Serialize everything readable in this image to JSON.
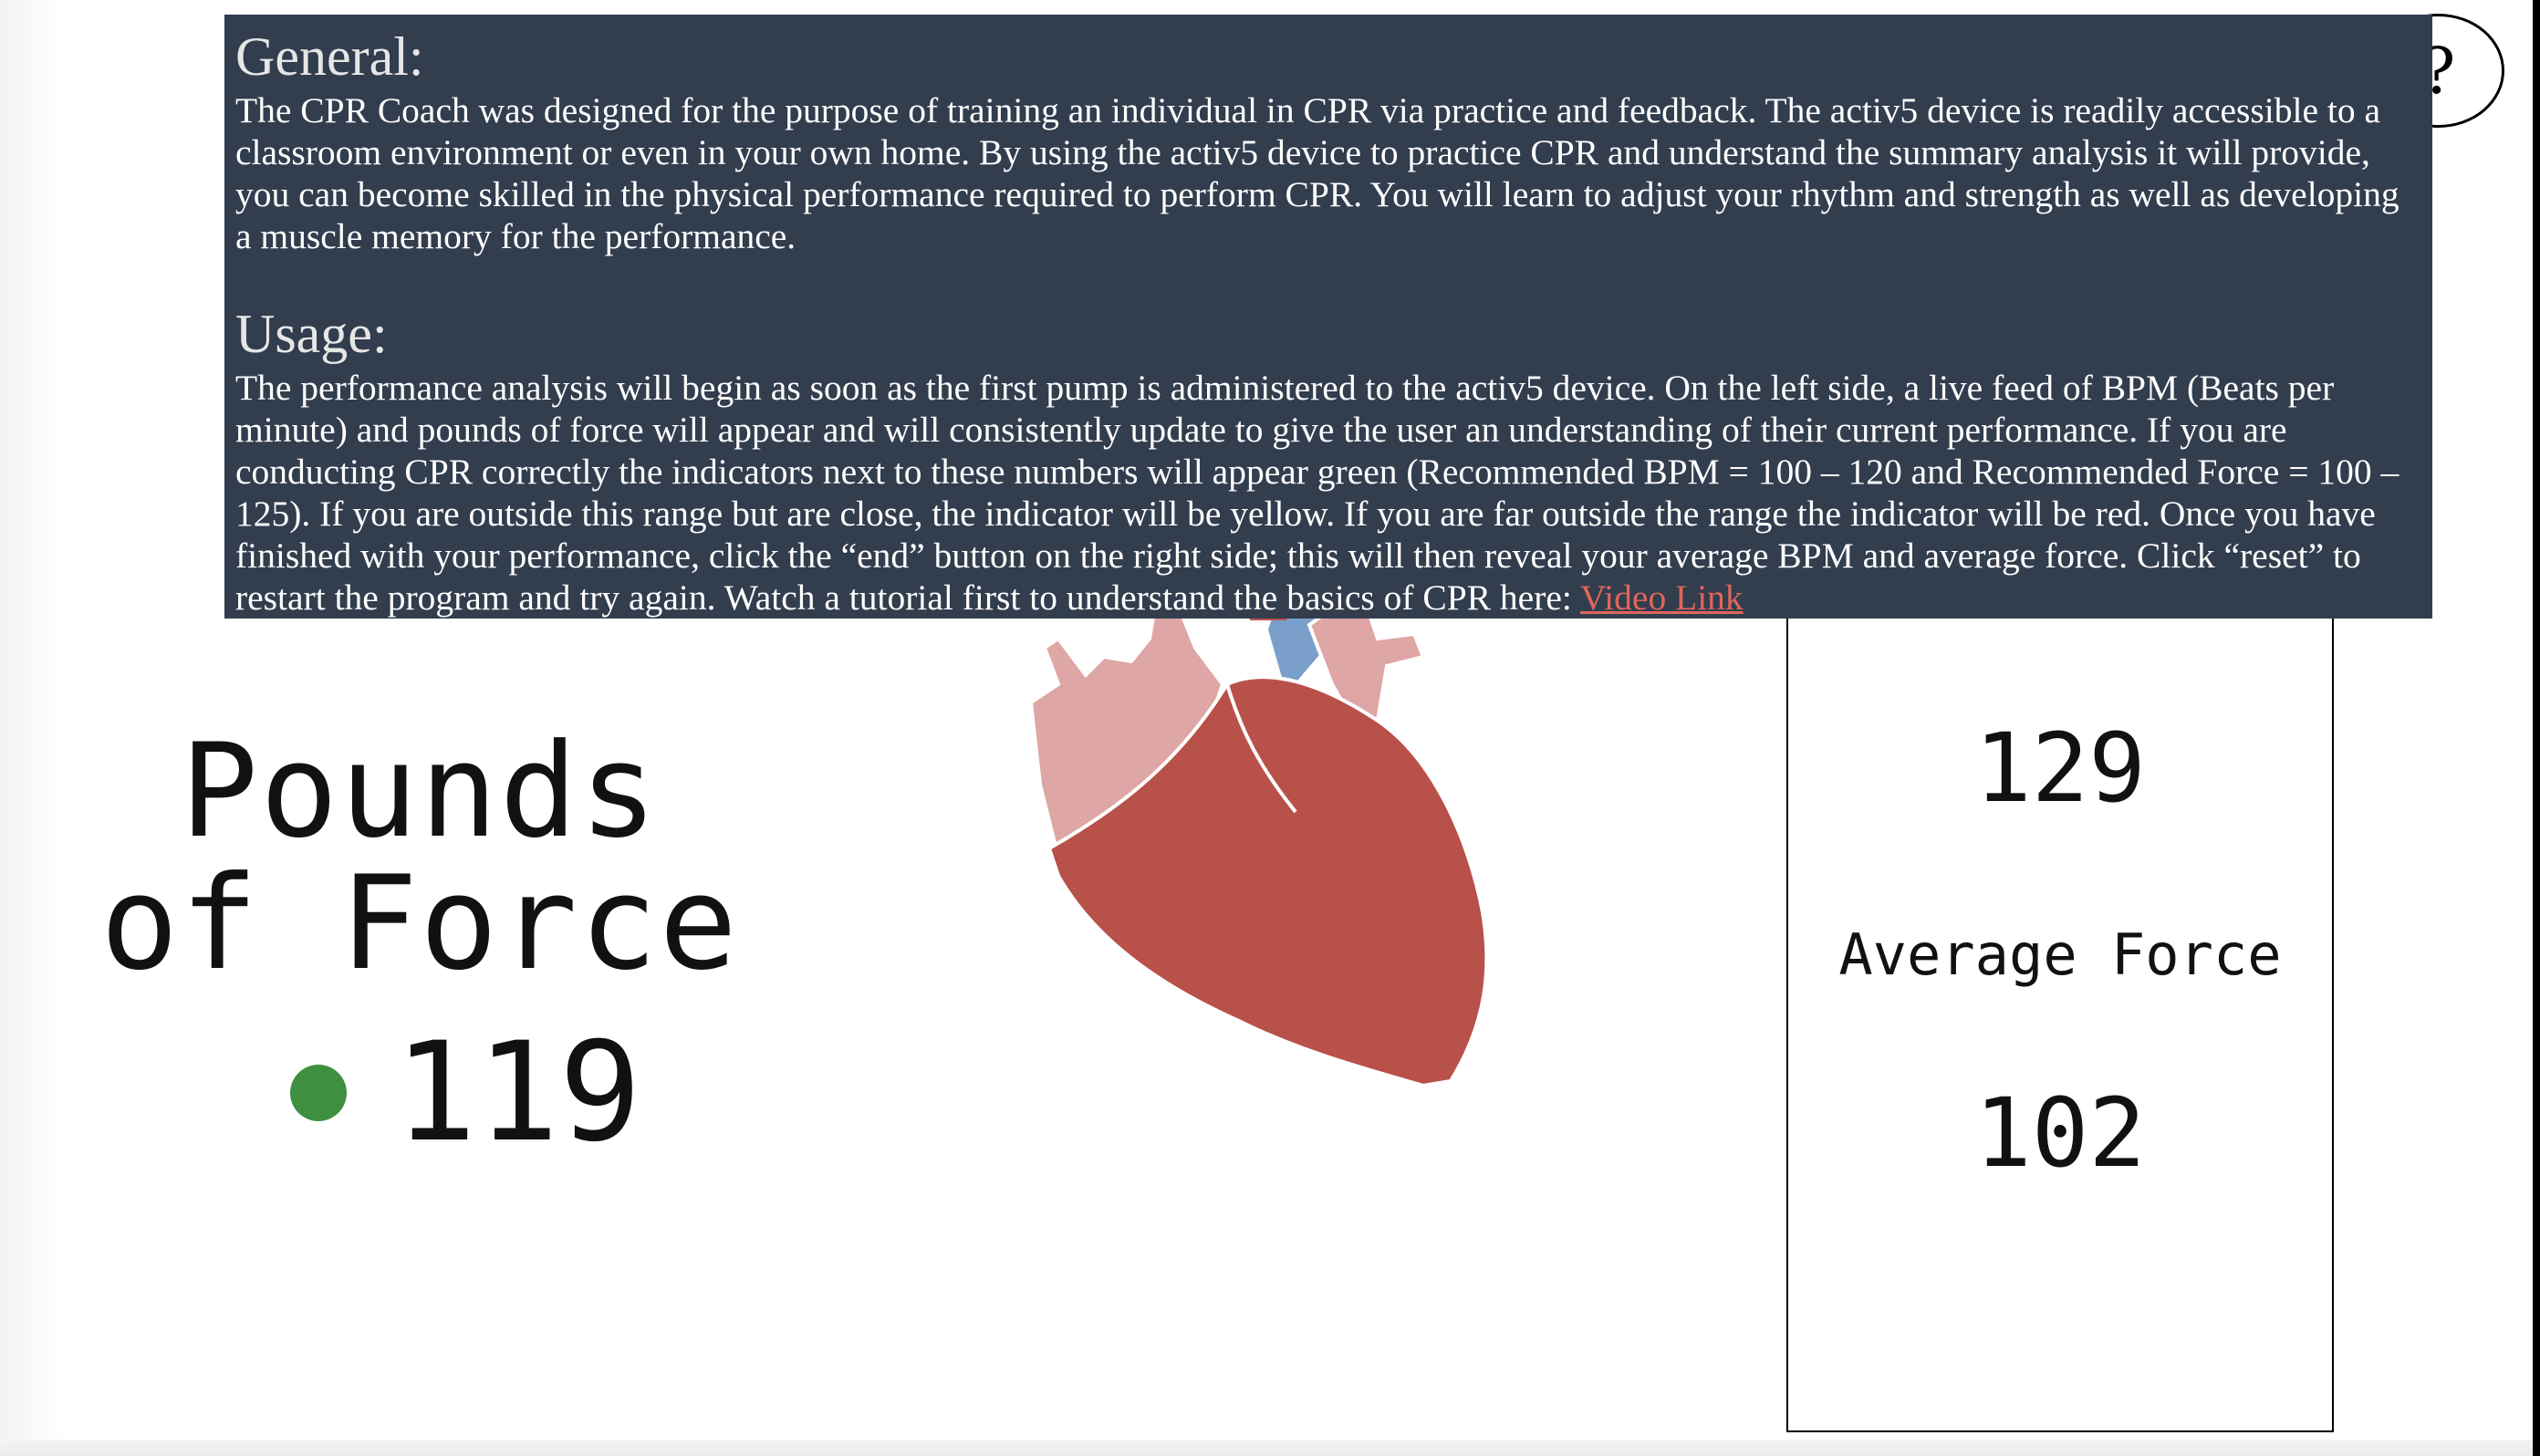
{
  "info": {
    "general_heading": "General:",
    "general_text": "The CPR Coach was designed for the purpose of training an individual in CPR via practice and feedback. The activ5 device is readily accessible to a classroom environment or even in your own home. By using the activ5 device to practice CPR and understand the summary analysis it will provide, you can become skilled in the physical performance required to perform CPR. You will learn to adjust your rhythm and strength as well as developing a muscle memory for the performance.",
    "usage_heading": "Usage:",
    "usage_text": "The performance analysis will begin as soon as the first pump is administered to the activ5 device. On the left side, a live feed of BPM (Beats per minute) and pounds of force will appear and will consistently update to give the user an understanding of their current performance. If you are conducting CPR correctly the indicators next to these numbers will appear green (Recommended BPM = 100 – 120 and Recommended Force = 100 – 125). If you are outside this range but are close, the indicator will be yellow. If you are far outside the range the indicator will be red. Once you have finished with your performance, click the “end” button on the right side; this will then reveal your average BPM and average force. Click “reset” to restart the program and try again. Watch a tutorial first to understand the basics of CPR here:",
    "video_link_label": "Video Link"
  },
  "help_button": {
    "label": "?"
  },
  "live": {
    "force_label": "Pounds of Force",
    "force_value": "119",
    "indicator_status": "green"
  },
  "summary": {
    "average_bpm_value": "129",
    "average_force_label": "Average Force",
    "average_force_value": "102"
  },
  "colors": {
    "overlay_bg": "#323d4e",
    "indicator_green": "#3f8f41",
    "heart_red": "#b85149",
    "heart_pink": "#dea6a4",
    "heart_blue": "#7b9fcb",
    "link": "#e0665a"
  },
  "icons": {
    "heart": "heart-illustration",
    "indicator": "status-dot"
  }
}
